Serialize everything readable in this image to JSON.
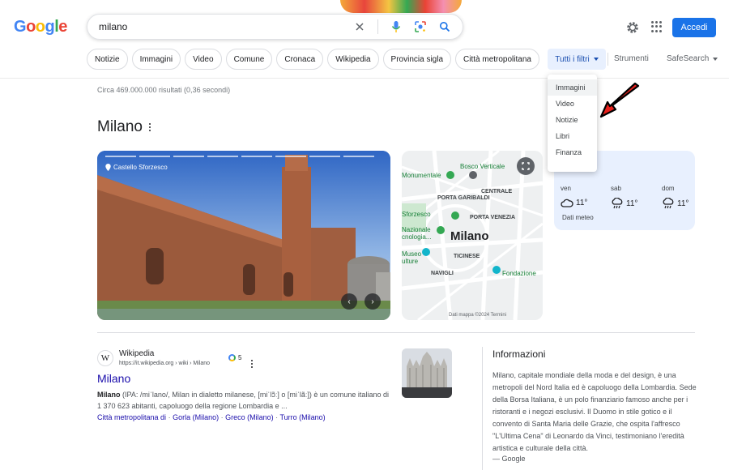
{
  "logo": {
    "letters": [
      "G",
      "o",
      "o",
      "g",
      "l",
      "e"
    ]
  },
  "search": {
    "query": "milano"
  },
  "header": {
    "signin_label": "Accedi"
  },
  "chips": [
    "Notizie",
    "Immagini",
    "Video",
    "Comune",
    "Cronaca",
    "Wikipedia",
    "Provincia sigla",
    "Città metropolitana"
  ],
  "toolbar": {
    "filters_label": "Tutti i filtri",
    "tools_label": "Strumenti",
    "safesearch_label": "SafeSearch"
  },
  "dropdown": {
    "items": [
      "Immagini",
      "Video",
      "Notizie",
      "Libri",
      "Finanza"
    ]
  },
  "stats": "Circa 469.000.000 risultati (0,36 secondi)",
  "knowledge": {
    "title": "Milano",
    "photo_caption": "Castello Sforzesco",
    "map": {
      "labels": [
        "Monumentale",
        "Bosco Verticale",
        "CENTRALE",
        "PORTA GARIBALDI",
        "Sforzesco",
        "PORTA VENEZIA",
        "Nazionale",
        "cnologia...",
        "Milano",
        "Museo",
        "ulture",
        "TICINESE",
        "NAVIGLI",
        "Fondazione"
      ],
      "footer": "Dati mappa ©2024   Termini"
    },
    "weather": {
      "days": [
        {
          "day": "ven",
          "temp": "11°",
          "icon": "cloud-icon"
        },
        {
          "day": "sab",
          "temp": "11°",
          "icon": "rain-cloud-icon"
        },
        {
          "day": "dom",
          "temp": "11°",
          "icon": "rain-cloud-icon"
        }
      ],
      "source": "Dati meteo"
    }
  },
  "result": {
    "site": "Wikipedia",
    "url": "https://it.wikipedia.org › wiki › Milano",
    "badge": "5",
    "title": "Milano",
    "snippet_bold": "Milano",
    "snippet_rest": " (IPA: /miˈlano/, Milan in dialetto milanese, [miˈlɔ̃ː] o [miˈlãː]) è un comune italiano di 1 370 623 abitanti, capoluogo della regione Lombardia e ...",
    "sublinks": [
      "Città metropolitana di",
      "Gorla (Milano)",
      "Greco (Milano)",
      "Turro (Milano)"
    ]
  },
  "info": {
    "title": "Informazioni",
    "text": "Milano, capitale mondiale della moda e del design, è una metropoli del Nord Italia ed è capoluogo della Lombardia. Sede della Borsa Italiana, è un polo finanziario famoso anche per i ristoranti e i negozi esclusivi. Il Duomo in stile gotico e il convento di Santa Maria delle Grazie, che ospita l'affresco \"L'Ultima Cena\" di Leonardo da Vinci, testimoniano l'eredità artistica e culturale della città.",
    "source": "— Google"
  },
  "colors": {
    "accent": "#1a73e8",
    "link": "#1a0dab",
    "arrow": "#e8201c"
  }
}
